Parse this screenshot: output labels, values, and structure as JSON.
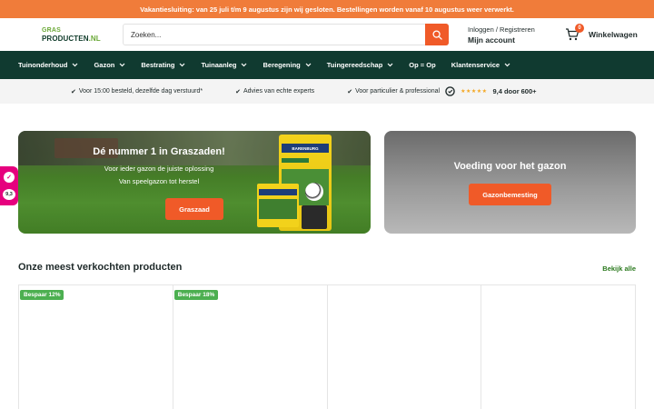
{
  "notice": "Vakantiesluiting: van 25 juli t/m 9 augustus zijn wij gesloten. Bestellingen worden vanaf 10 augustus weer verwerkt.",
  "logo": {
    "line1": "GRAS",
    "line2a": "PRODUCTEN",
    "line2b": ".NL"
  },
  "search": {
    "placeholder": "Zoeken..."
  },
  "account": {
    "line1": "Inloggen / Registreren",
    "line2": "Mijn account"
  },
  "cart": {
    "count": "0",
    "label": "Winkelwagen"
  },
  "nav": [
    {
      "label": "Tuinonderhoud",
      "dropdown": true
    },
    {
      "label": "Gazon",
      "dropdown": true
    },
    {
      "label": "Bestrating",
      "dropdown": true
    },
    {
      "label": "Tuinaanleg",
      "dropdown": true
    },
    {
      "label": "Beregening",
      "dropdown": true
    },
    {
      "label": "Tuingereedschap",
      "dropdown": true
    },
    {
      "label": "Op = Op",
      "dropdown": false
    },
    {
      "label": "Klantenservice",
      "dropdown": true
    }
  ],
  "usp": [
    "Voor 15:00 besteld, dezelfde dag verstuurd*",
    "Advies van echte experts",
    "Voor particulier & professional"
  ],
  "rating": {
    "stars": 5,
    "score": "9,4 door",
    "count": "600+"
  },
  "banner_left": {
    "title": "Dé nummer 1 in Graszaden!",
    "sub1": "Voor ieder gazon de juiste oplossing",
    "sub2": "Van speelgazon tot herstel",
    "button": "Graszaad",
    "bag_brand": "BARENBURG"
  },
  "banner_right": {
    "title": "Voeding voor het gazon",
    "button": "Gazonbemesting"
  },
  "side_badge": {
    "score": "9,3"
  },
  "section": {
    "title": "Onze meest verkochten producten",
    "see_all": "Bekijk alle"
  },
  "products": [
    {
      "tag": "Bespaar 12%"
    },
    {
      "tag": "Bespaar 18%"
    },
    {
      "tag": ""
    },
    {
      "tag": ""
    }
  ],
  "colors": {
    "accent": "#f05a28",
    "nav_bg": "#103a30",
    "notice_bg": "#f07c3a",
    "tag_green": "#4caf50"
  }
}
